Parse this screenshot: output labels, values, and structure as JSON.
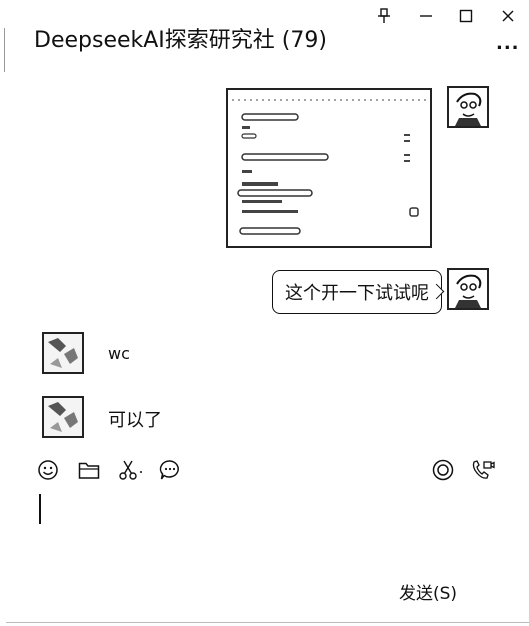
{
  "window": {
    "title": "DeepseekAI探索研究社 (79)",
    "controls": {
      "pin_icon": "pin-icon",
      "minimize_icon": "minimize-icon",
      "maximize_icon": "maximize-icon",
      "close_icon": "close-icon"
    },
    "more_label": "..."
  },
  "messages": [
    {
      "side": "right",
      "type": "image"
    },
    {
      "side": "right",
      "type": "text",
      "text": "这个开一下试试呢"
    },
    {
      "side": "left",
      "type": "text",
      "text": "wc"
    },
    {
      "side": "left",
      "type": "text",
      "text": "可以了"
    }
  ],
  "toolbar": {
    "left": [
      "emoji-icon",
      "folder-icon",
      "scissors-icon",
      "chat-bubble-icon"
    ],
    "right": [
      "record-icon",
      "video-call-icon"
    ]
  },
  "composer": {
    "value": ""
  },
  "send_label": "发送(S)"
}
